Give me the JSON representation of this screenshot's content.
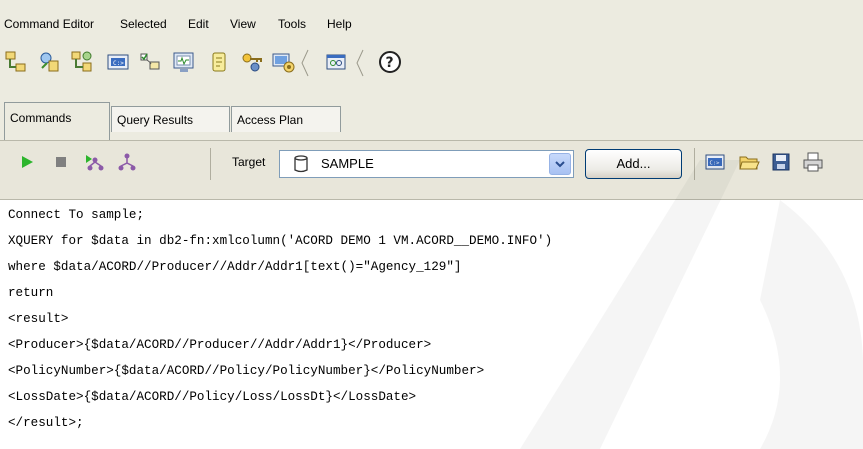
{
  "menu": [
    "Command Editor",
    "Selected",
    "Edit",
    "View",
    "Tools",
    "Help"
  ],
  "toolbar_icons": [
    "control-center-icon",
    "replication-center-icon",
    "satellite-admin-icon",
    "command-editor-icon",
    "task-center-icon",
    "health-center-icon",
    "journal-icon",
    "license-center-icon",
    "configuration-assistant-icon",
    "tools-settings-icon",
    "help-icon"
  ],
  "tabs": [
    "Commands",
    "Query Results",
    "Access Plan"
  ],
  "command_bar": {
    "target_label": "Target",
    "target_value": "SAMPLE",
    "add_label": "Add..."
  },
  "editor": {
    "lines": [
      "Connect To sample;",
      "XQUERY for $data in db2-fn:xmlcolumn('ACORD DEMO 1 VM.ACORD__DEMO.INFO')",
      "where $data/ACORD//Producer//Addr/Addr1[text()=\"Agency_129\"]",
      "return",
      "<result>",
      "<Producer>{$data/ACORD//Producer//Addr/Addr1}</Producer>",
      "<PolicyNumber>{$data/ACORD//Policy/PolicyNumber}</PolicyNumber>",
      "<LossDate>{$data/ACORD//Policy/Loss/LossDt}</LossDate>",
      "</result>;"
    ]
  },
  "colors": {
    "chrome": "#ecebe0",
    "run": "#2db52d",
    "stop": "#808080",
    "select_border": "#7f9db9"
  }
}
